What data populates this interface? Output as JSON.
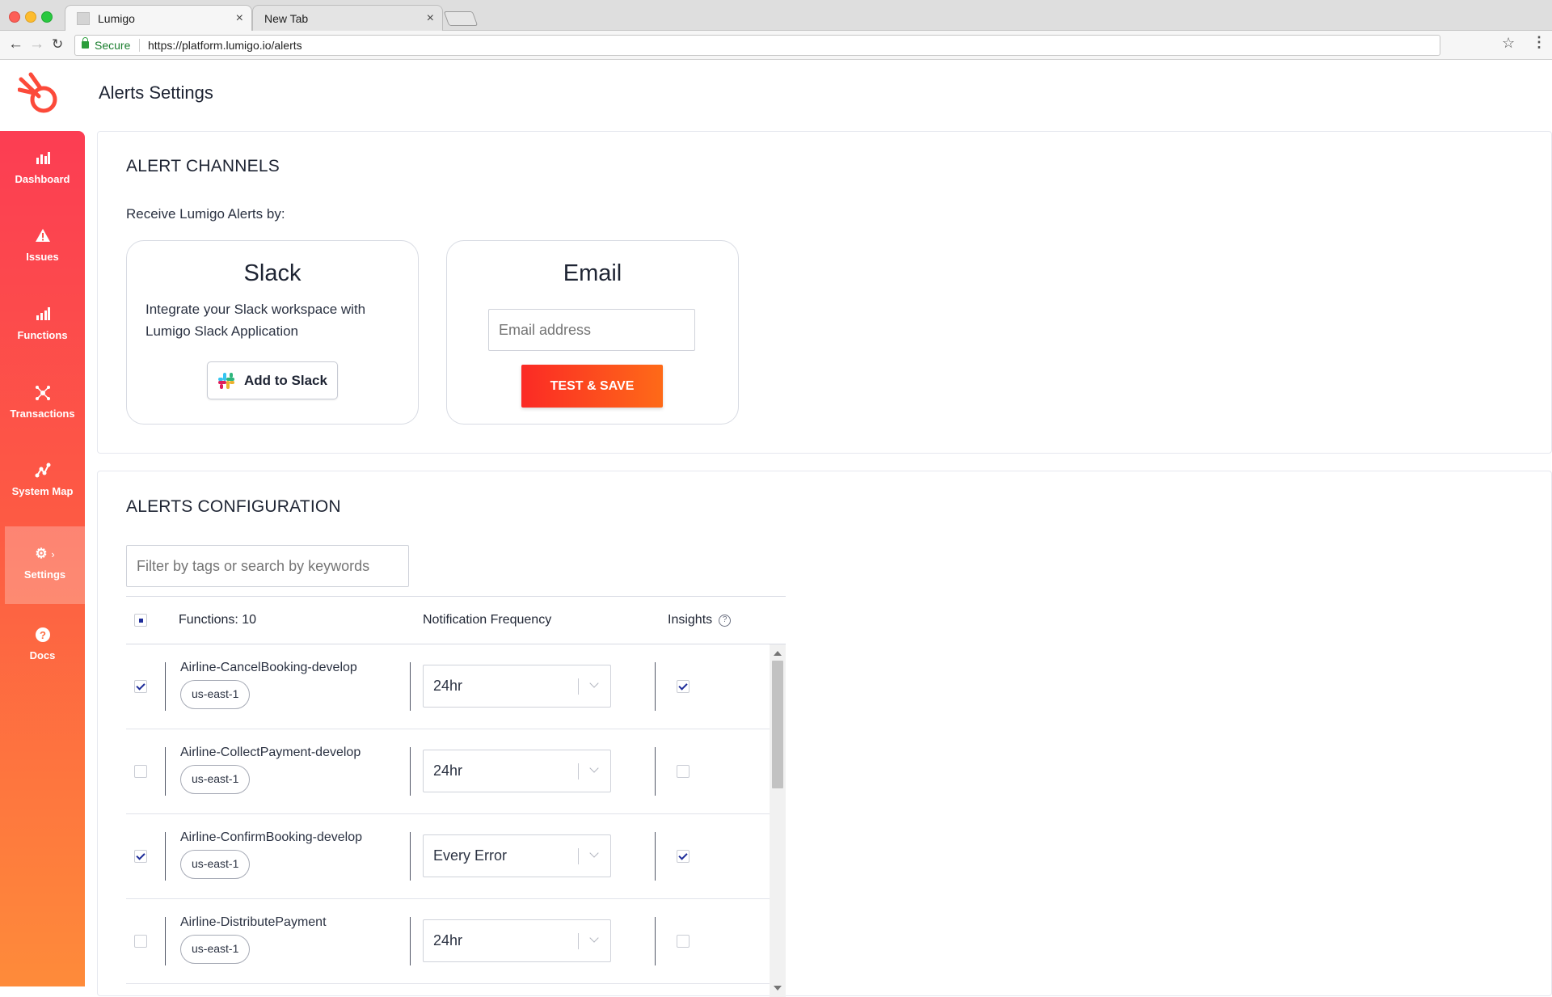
{
  "browser": {
    "tabs": [
      {
        "title": "Lumigo",
        "active": true
      },
      {
        "title": "New Tab",
        "active": false
      }
    ],
    "security_label": "Secure",
    "url": "https://platform.lumigo.io/alerts"
  },
  "header": {
    "title": "Alerts Settings"
  },
  "sidebar": {
    "items": [
      {
        "label": "Dashboard",
        "icon": "dashboard-icon",
        "active": false
      },
      {
        "label": "Issues",
        "icon": "warning-icon",
        "active": false
      },
      {
        "label": "Functions",
        "icon": "functions-icon",
        "active": false
      },
      {
        "label": "Transactions",
        "icon": "transactions-icon",
        "active": false
      },
      {
        "label": "System Map",
        "icon": "system-map-icon",
        "active": false
      },
      {
        "label": "Settings",
        "icon": "gear-icon",
        "active": true
      },
      {
        "label": "Docs",
        "icon": "help-icon",
        "active": false
      }
    ]
  },
  "alert_channels": {
    "title": "ALERT CHANNELS",
    "subtitle": "Receive Lumigo Alerts by:",
    "slack": {
      "heading": "Slack",
      "description": "Integrate your Slack workspace with Lumigo Slack Application",
      "button_label": "Add to Slack"
    },
    "email": {
      "heading": "Email",
      "input_placeholder": "Email address",
      "button_label": "TEST & SAVE"
    }
  },
  "alerts_configuration": {
    "title": "ALERTS CONFIGURATION",
    "filter_placeholder": "Filter by tags or search by keywords",
    "columns": {
      "functions": "Functions: 10",
      "frequency": "Notification Frequency",
      "insights": "Insights"
    },
    "rows": [
      {
        "name": "Airline-CancelBooking-develop",
        "region": "us-east-1",
        "frequency": "24hr",
        "selected": true,
        "insights": true
      },
      {
        "name": "Airline-CollectPayment-develop",
        "region": "us-east-1",
        "frequency": "24hr",
        "selected": false,
        "insights": false
      },
      {
        "name": "Airline-ConfirmBooking-develop",
        "region": "us-east-1",
        "frequency": "Every Error",
        "selected": true,
        "insights": true
      },
      {
        "name": "Airline-DistributePayment",
        "region": "us-east-1",
        "frequency": "24hr",
        "selected": false,
        "insights": false
      }
    ]
  },
  "colors": {
    "sidebar_gradient_top": "#fc3d53",
    "sidebar_gradient_bottom": "#fe8b3a",
    "primary_button": "#fb2a25",
    "checkbox_check": "#1f2e9a"
  }
}
